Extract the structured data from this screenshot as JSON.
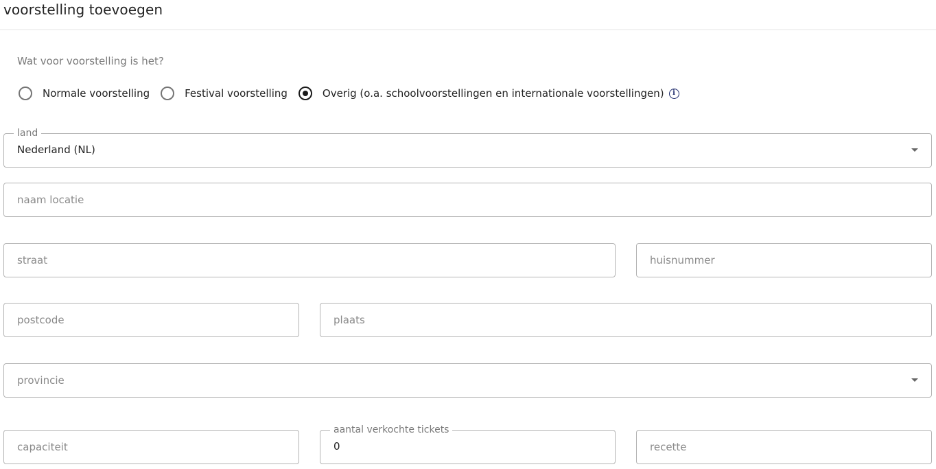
{
  "header": {
    "title": "voorstelling toevoegen"
  },
  "form": {
    "question": "Wat voor voorstelling is het?",
    "type_options": [
      {
        "label": "Normale voorstelling",
        "checked": false
      },
      {
        "label": "Festival voorstelling",
        "checked": false
      },
      {
        "label": "Overig (o.a. schoolvoorstellingen en internationale voorstellingen)",
        "checked": true
      }
    ],
    "info_icon": "info-icon",
    "land": {
      "label": "land",
      "value": "Nederland (NL)"
    },
    "naam_locatie": {
      "placeholder": "naam locatie"
    },
    "straat": {
      "placeholder": "straat"
    },
    "huisnummer": {
      "placeholder": "huisnummer"
    },
    "postcode": {
      "placeholder": "postcode"
    },
    "plaats": {
      "placeholder": "plaats"
    },
    "provincie": {
      "placeholder": "provincie"
    },
    "capaciteit": {
      "placeholder": "capaciteit"
    },
    "tickets": {
      "label": "aantal verkochte tickets",
      "value": "0"
    },
    "recette": {
      "placeholder": "recette"
    }
  }
}
